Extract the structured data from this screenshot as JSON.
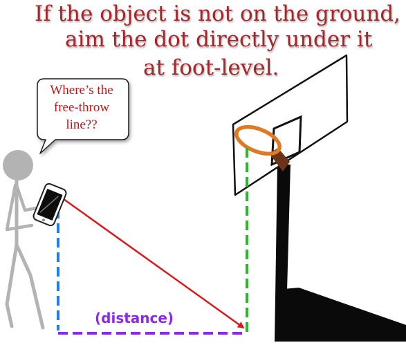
{
  "heading": {
    "line1": "If the object is not on the ground,",
    "line2": "aim the dot directly under it",
    "line3": "at foot-level."
  },
  "speech_bubble": {
    "line1": "Where’s  the",
    "line2": "free-throw",
    "line3": "line??"
  },
  "distance_label": "(distance)",
  "colors": {
    "heading": "#a5272b",
    "bubble_text": "#c0171c",
    "height_line": "#1e7ef0",
    "aim_line": "#d8191b",
    "distance_line": "#8d27ef",
    "target_line": "#2cb82c",
    "hoop_ring": "#e07a22",
    "person": "#b3b3b3"
  }
}
